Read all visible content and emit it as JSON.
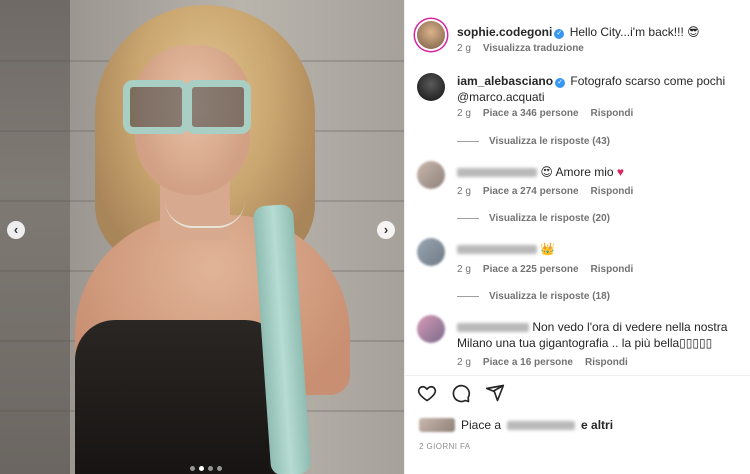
{
  "post": {
    "author": "sophie.codegoni",
    "caption": "Hello City...i'm back!!!",
    "caption_emoji": "😎",
    "time": "2 g",
    "translate": "Visualizza traduzione"
  },
  "comments": [
    {
      "username": "iam_alebasciano",
      "text": "Fotografo scarso come pochi",
      "mention": "@marco.acquati",
      "time": "2 g",
      "likes": "Piace a 346 persone",
      "reply": "Rispondi",
      "view_replies": "Visualizza le risposte (43)"
    },
    {
      "text": "Amore mio",
      "time": "2 g",
      "likes": "Piace a 274 persone",
      "reply": "Rispondi",
      "view_replies": "Visualizza le risposte (20)"
    },
    {
      "emoji": "👑",
      "time": "2 g",
      "likes": "Piace a 225 persone",
      "reply": "Rispondi",
      "view_replies": "Visualizza le risposte (18)"
    },
    {
      "text": "Non vedo l'ora di vedere nella nostra Milano una tua gigantografia .. la più bella▯▯▯▯▯",
      "time": "2 g",
      "likes": "Piace a 16 persone",
      "reply": "Rispondi"
    }
  ],
  "footer": {
    "liked_prefix": "Piace a",
    "liked_suffix": "e altri",
    "date": "2 GIORNI FA"
  },
  "icons": [
    "chevron-left-icon",
    "chevron-right-icon",
    "heart-icon",
    "comment-icon",
    "share-icon",
    "verified-icon"
  ],
  "colors": {
    "verified": "#3897f0",
    "meta": "#737373",
    "heart": "#e0245e"
  }
}
